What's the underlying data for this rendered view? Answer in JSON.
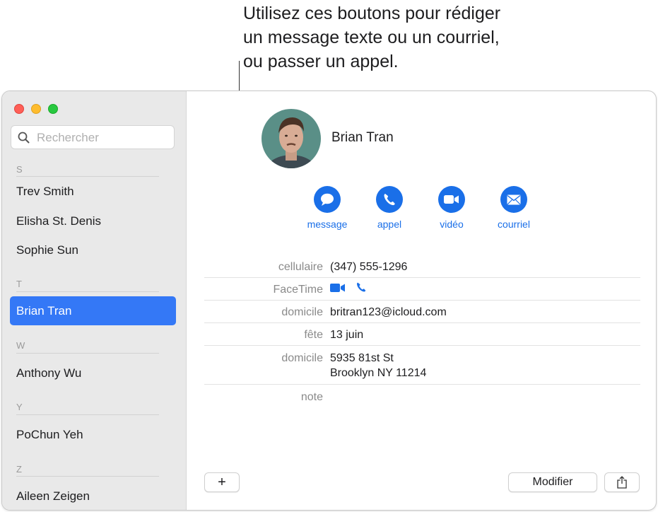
{
  "callout": {
    "lines": [
      "Utilisez ces boutons pour rédiger",
      "un message texte ou un courriel,",
      "ou passer un appel."
    ]
  },
  "sidebar": {
    "search_placeholder": "Rechercher",
    "sections": [
      {
        "letter": "S",
        "contacts": [
          "Trev Smith",
          "Elisha St. Denis",
          "Sophie Sun"
        ]
      },
      {
        "letter": "T",
        "contacts": [
          "Brian Tran"
        ]
      },
      {
        "letter": "W",
        "contacts": [
          "Anthony Wu"
        ]
      },
      {
        "letter": "Y",
        "contacts": [
          "PoChun Yeh"
        ]
      },
      {
        "letter": "Z",
        "contacts": [
          "Aileen Zeigen"
        ]
      }
    ],
    "selected": "Brian Tran"
  },
  "card": {
    "name": "Brian Tran",
    "actions": [
      {
        "label": "message",
        "icon": "message-bubble-icon"
      },
      {
        "label": "appel",
        "icon": "phone-icon"
      },
      {
        "label": "vidéo",
        "icon": "video-camera-icon"
      },
      {
        "label": "courriel",
        "icon": "envelope-icon"
      }
    ],
    "fields": {
      "mobile_label": "cellulaire",
      "mobile_value": "(347) 555-1296",
      "facetime_label": "FaceTime",
      "email_label": "domicile",
      "email_value": "britran123@icloud.com",
      "birthday_label": "fête",
      "birthday_value": "13 juin",
      "address_label": "domicile",
      "address_line1": "5935 81st St",
      "address_line2": "Brooklyn NY 11214",
      "note_label": "note"
    }
  },
  "footer": {
    "add_label": "+",
    "edit_label": "Modifier"
  },
  "colors": {
    "accent": "#1a6fe8",
    "selection": "#3478f6",
    "sidebar_bg": "#e9e9e9"
  }
}
